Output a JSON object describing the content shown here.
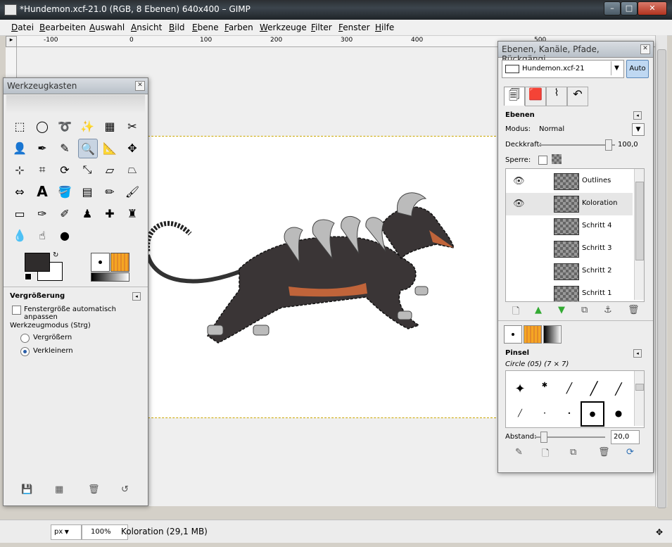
{
  "window": {
    "title": "*Hundemon.xcf-21.0 (RGB, 8 Ebenen) 640x400 – GIMP"
  },
  "menu": [
    "Datei",
    "Bearbeiten",
    "Auswahl",
    "Ansicht",
    "Bild",
    "Ebene",
    "Farben",
    "Werkzeuge",
    "Filter",
    "Fenster",
    "Hilfe"
  ],
  "ruler": [
    "-100",
    "0",
    "100",
    "200",
    "300",
    "400",
    "500"
  ],
  "toolbox": {
    "title": "Werkzeugkasten",
    "options_title": "Vergrößerung",
    "auto_resize": "Fenstergröße automatisch anpassen",
    "mode_label": "Werkzeugmodus (Strg)",
    "mode_in": "Vergrößern",
    "mode_out": "Verkleinern"
  },
  "dock": {
    "title": "Ebenen, Kanäle, Pfade, Rückgängi...",
    "image_select": "Hundemon.xcf-21",
    "auto": "Auto",
    "layers_title": "Ebenen",
    "mode_label": "Modus:",
    "mode_value": "Normal",
    "opacity_label": "Deckkraft:",
    "opacity_value": "100,0",
    "lock_label": "Sperre:",
    "layers": [
      "Outlines",
      "Koloration",
      "Schritt 4",
      "Schritt 3",
      "Schritt 2",
      "Schritt 1"
    ],
    "brushes_title": "Pinsel",
    "brush_name": "Circle (05) (7 × 7)",
    "spacing_label": "Abstand:",
    "spacing_value": "20,0"
  },
  "status": {
    "unit": "px",
    "zoom": "100%",
    "info": "Koloration (29,1 MB)"
  }
}
